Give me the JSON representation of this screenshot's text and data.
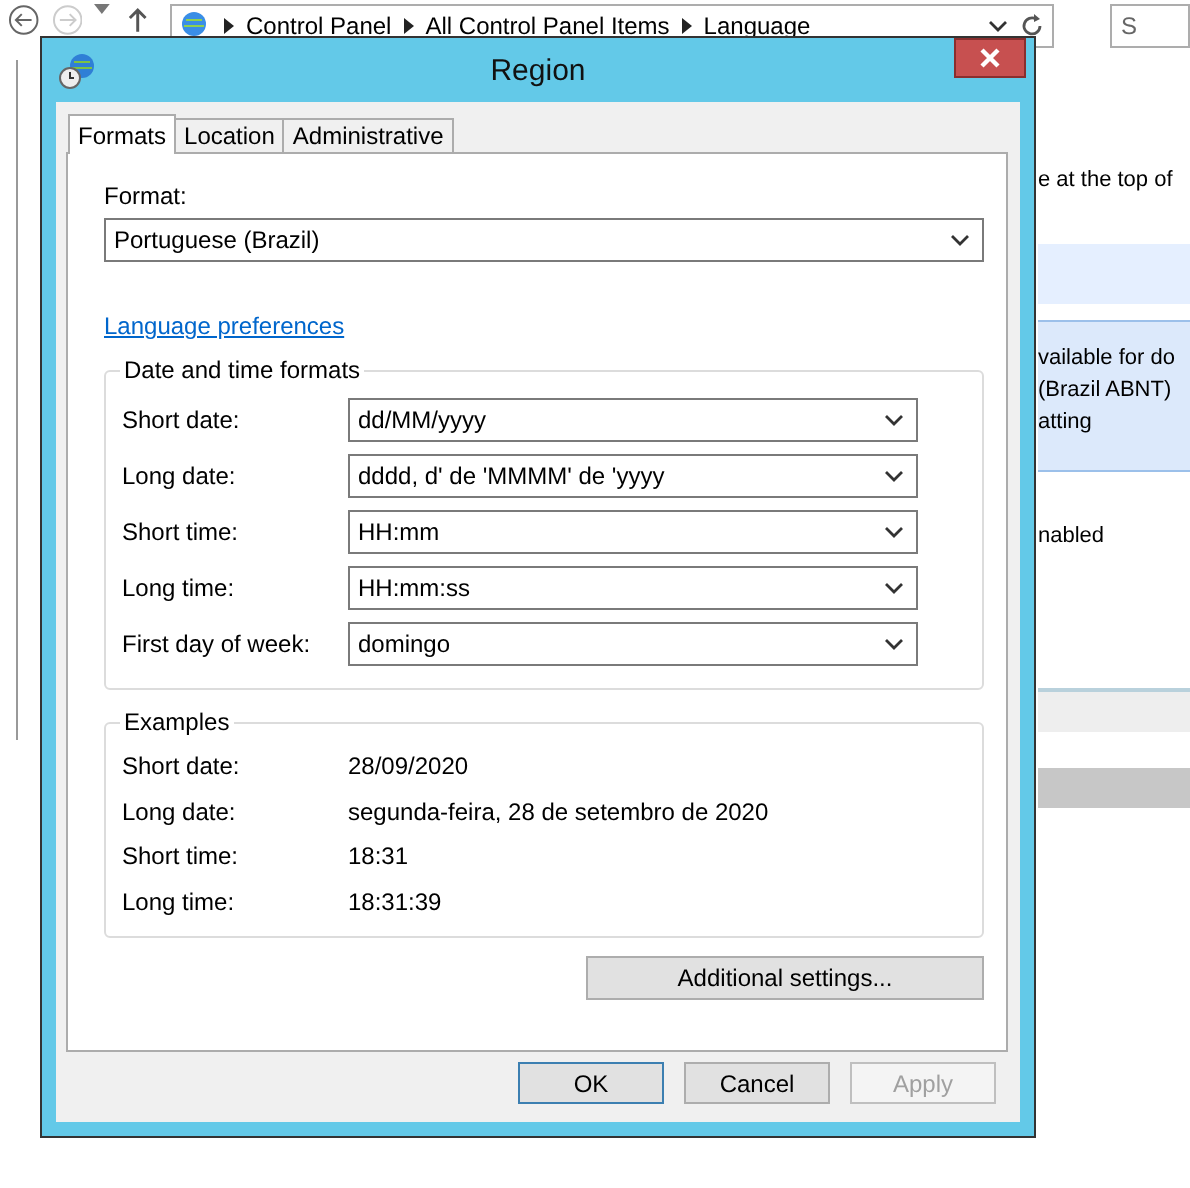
{
  "explorer": {
    "breadcrumb": [
      "Control Panel",
      "All Control Panel Items",
      "Language"
    ],
    "search_placeholder": "S",
    "intro_text": "e at the top of",
    "item_lines": [
      "vailable for do",
      "(Brazil ABNT)",
      "atting"
    ],
    "status_text": "nabled"
  },
  "dialog": {
    "title": "Region",
    "tabs": [
      {
        "label": "Formats",
        "selected": true
      },
      {
        "label": "Location",
        "selected": false
      },
      {
        "label": "Administrative",
        "selected": false
      }
    ],
    "format_label": "Format:",
    "format_value": "Portuguese (Brazil)",
    "link": "Language preferences",
    "formats_group": {
      "title": "Date and time formats",
      "rows": [
        {
          "label": "Short date:",
          "value": "dd/MM/yyyy"
        },
        {
          "label": "Long date:",
          "value": "dddd, d' de 'MMMM' de 'yyyy"
        },
        {
          "label": "Short time:",
          "value": "HH:mm"
        },
        {
          "label": "Long time:",
          "value": "HH:mm:ss"
        },
        {
          "label": "First day of week:",
          "value": "domingo"
        }
      ]
    },
    "examples_group": {
      "title": "Examples",
      "rows": [
        {
          "label": "Short date:",
          "value": "28/09/2020"
        },
        {
          "label": "Long date:",
          "value": "segunda-feira, 28 de setembro de 2020"
        },
        {
          "label": "Short time:",
          "value": "18:31"
        },
        {
          "label": "Long time:",
          "value": "18:31:39"
        }
      ]
    },
    "additional_button": "Additional settings...",
    "buttons": [
      {
        "label": "OK",
        "default": true,
        "disabled": false
      },
      {
        "label": "Cancel",
        "default": false,
        "disabled": false
      },
      {
        "label": "Apply",
        "default": false,
        "disabled": true
      }
    ]
  }
}
